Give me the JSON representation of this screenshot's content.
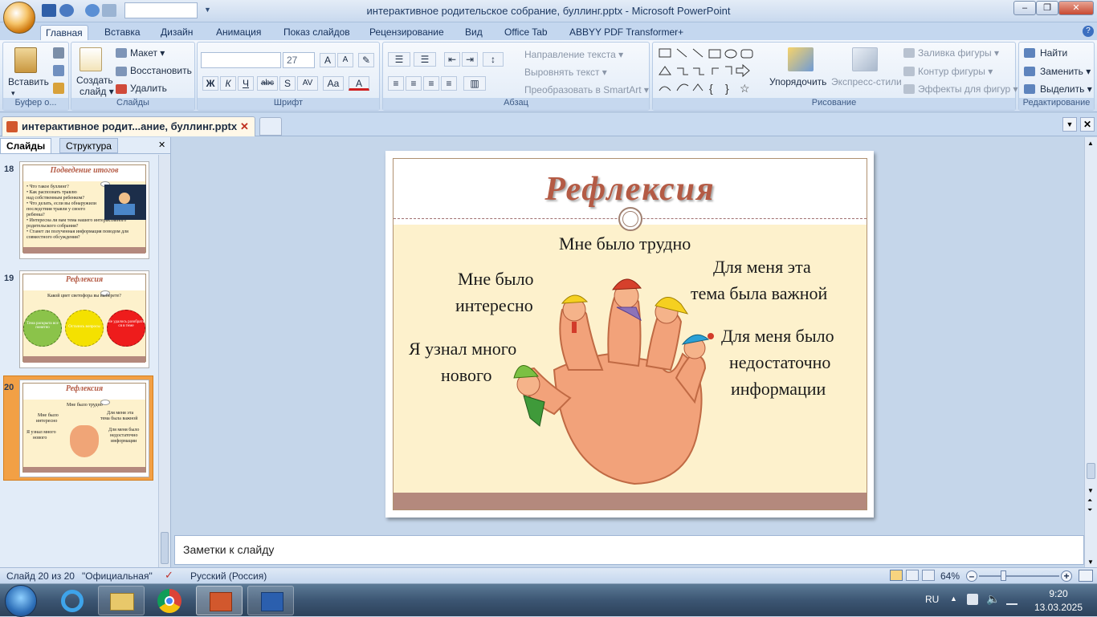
{
  "window": {
    "title": "интерактивное родительское собрание, буллинг.pptx - Microsoft PowerPoint",
    "min": "–",
    "max": "❐",
    "close": "✕"
  },
  "ribbon_tabs": [
    "Главная",
    "Вставка",
    "Дизайн",
    "Анимация",
    "Показ слайдов",
    "Рецензирование",
    "Вид",
    "Office Tab",
    "ABBYY PDF Transformer+"
  ],
  "clipboard": {
    "paste": "Вставить",
    "label": "Буфер о..."
  },
  "slides_group": {
    "new_slide_1": "Создать",
    "new_slide_2": "слайд ▾",
    "layout": "Макет ▾",
    "reset": "Восстановить",
    "delete": "Удалить",
    "label": "Слайды"
  },
  "font_group": {
    "size": "27",
    "label": "Шрифт",
    "bold": "Ж",
    "italic": "К",
    "underline": "Ч",
    "strike": "abc",
    "shadow": "S",
    "spacing": "AV",
    "case": "Aa",
    "color": "A"
  },
  "paragraph_group": {
    "direction": "Направление текста ▾",
    "align_text": "Выровнять текст ▾",
    "smartart": "Преобразовать в SmartArt ▾",
    "label": "Абзац"
  },
  "drawing_group": {
    "arrange": "Упорядочить",
    "quick_styles": "Экспресс-стили",
    "fill": "Заливка фигуры ▾",
    "outline": "Контур фигуры ▾",
    "effects": "Эффекты для фигур ▾",
    "label": "Рисование"
  },
  "editing_group": {
    "find": "Найти",
    "replace": "Заменить ▾",
    "select": "Выделить ▾",
    "label": "Редактирование"
  },
  "doc_tab": {
    "name": "интерактивное родит...ание, буллинг.pptx"
  },
  "left_pane": {
    "tab_slides": "Слайды",
    "tab_outline": "Структура",
    "slides": [
      {
        "num": "18",
        "title": "Подведение итогов",
        "lines": [
          "• Что такое буллинг?",
          "• Как распознать травлю",
          "над собственным ребенком?",
          "• Что делать, если вы обнаружили",
          "последствия травли у своего",
          "ребенка?",
          "• Интересна ли вам тема нашего интерактивного",
          "родительского собрания?",
          "• Станет ли полученная информация поводом для",
          "совместного обсуждения?"
        ]
      },
      {
        "num": "19",
        "title": "Рефлексия",
        "question": "Какой цвет светофора вы выберете?",
        "circles": [
          {
            "text": "Тема раскрыта все понятно",
            "color": "#8bc34a"
          },
          {
            "text": "Остались вопросы",
            "color": "#f4e100"
          },
          {
            "text": "Не удалось разобрать ся в теме",
            "color": "#ee1c1c"
          }
        ]
      },
      {
        "num": "20",
        "title": "Рефлексия"
      }
    ]
  },
  "slide": {
    "title": "Рефлексия",
    "labels": {
      "hard": "Мне было трудно",
      "important_1": "Для меня эта",
      "important_2": "тема была важной",
      "interesting_1": "Мне было",
      "interesting_2": "интересно",
      "learned_1": "Я узнал много",
      "learned_2": "нового",
      "notenough_1": "Для меня было",
      "notenough_2": "недостаточно",
      "notenough_3": "информации"
    },
    "colors": {
      "header": "#ffffff",
      "body": "#fdf1cc",
      "footer": "#b4897d",
      "title": "#b45b45"
    }
  },
  "notes": {
    "placeholder": "Заметки к слайду"
  },
  "status": {
    "slide": "Слайд 20 из 20",
    "theme": "\"Официальная\"",
    "lang": "Русский (Россия)",
    "zoom": "64%"
  },
  "taskbar": {
    "lang": "RU",
    "time": "9:20",
    "date": "13.03.2025"
  }
}
